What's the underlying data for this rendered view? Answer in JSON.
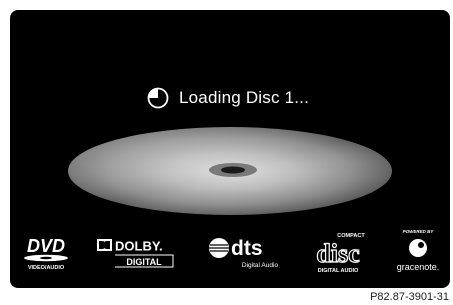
{
  "status": {
    "icon": "loading-spinner-icon",
    "text": "Loading Disc 1..."
  },
  "media": {
    "icon": "compact-disc-icon"
  },
  "logos": {
    "dvd": {
      "icon": "dvd-logo",
      "main": "DVD",
      "sub": "VIDEO/AUDIO"
    },
    "dolby": {
      "icon": "dolby-logo",
      "main": "DOLBY.",
      "sub": "DIGITAL"
    },
    "dts": {
      "icon": "dts-logo",
      "main": "dts",
      "sub": "Digital Audio"
    },
    "compact_disc": {
      "icon": "compact-disc-logo",
      "top": "COMPACT",
      "main": "disc",
      "sub": "DIGITAL AUDIO"
    },
    "gracenote": {
      "icon": "gracenote-logo",
      "top": "POWERED BY",
      "main": "gracenote."
    }
  },
  "caption": "P82.87-3901-31",
  "colors": {
    "screen_background": "#000000",
    "text": "#ffffff",
    "disc": "#a8a8a8",
    "page_background": "#ffffff"
  }
}
